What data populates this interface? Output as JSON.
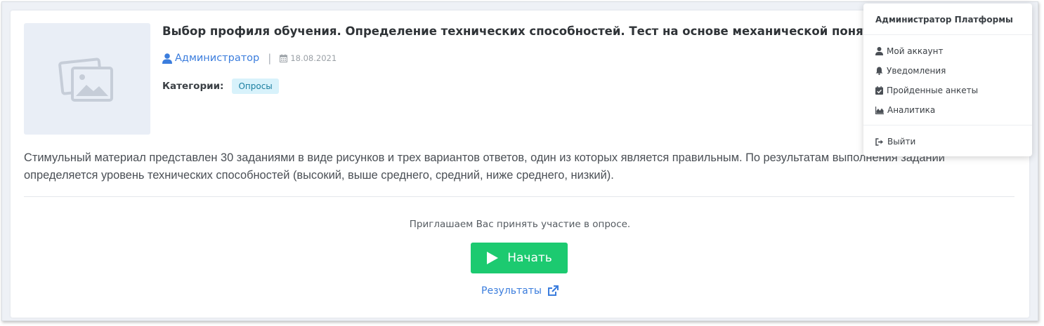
{
  "post": {
    "title": "Выбор профиля обучения. Определение технических способностей. Тест на основе механической понятливости",
    "author": "Администратор",
    "separator": "|",
    "date": "18.08.2021",
    "categories_label": "Категории:",
    "category": "Опросы",
    "description": "Стимульный материал представлен 30 заданиями в виде рисунков и трех вариантов ответов, один из которых является правильным. По результатам выполнения заданий определяется уровень технических способностей (высокий, выше среднего, средний, ниже среднего, низкий)."
  },
  "survey": {
    "invite_text": "Приглашаем Вас принять участие в опросе.",
    "start_label": "Начать",
    "results_label": "Результаты"
  },
  "user_menu": {
    "header": "Администратор Платформы",
    "items": [
      {
        "label": "Мой аккаунт",
        "icon": "user-icon"
      },
      {
        "label": "Уведомления",
        "icon": "bell-icon"
      },
      {
        "label": "Пройденные анкеты",
        "icon": "calendar-check-icon"
      },
      {
        "label": "Аналитика",
        "icon": "area-chart-icon"
      }
    ],
    "logout_label": "Выйти",
    "logout_icon": "sign-out-icon"
  },
  "colors": {
    "accent": "#3b7ddd",
    "start_button": "#1cca70",
    "badge_bg": "#d8f2fb",
    "badge_text": "#1a7ea0"
  }
}
